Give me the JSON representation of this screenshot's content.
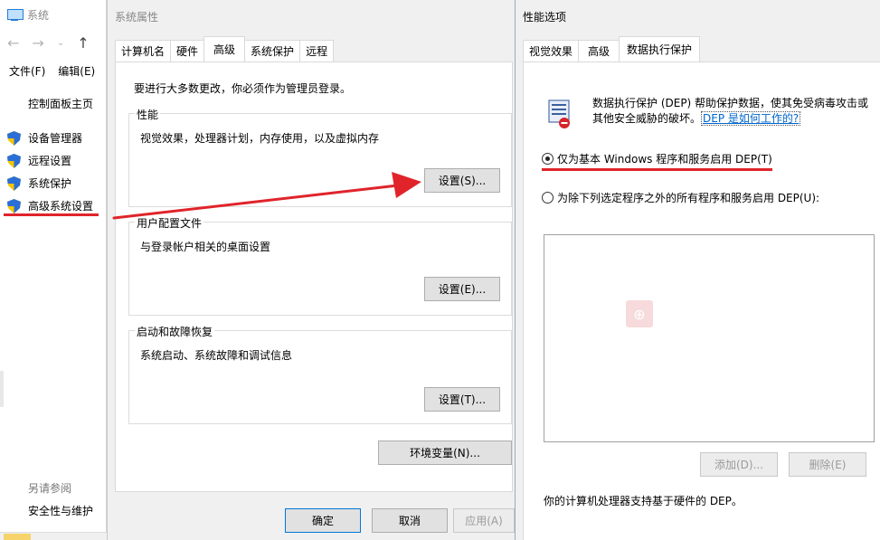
{
  "system": {
    "title": "系统",
    "menu": [
      "文件(F)",
      "编辑(E)"
    ],
    "home": "控制面板主页",
    "links": [
      "设备管理器",
      "远程设置",
      "系统保护",
      "高级系统设置"
    ],
    "see_also": "另请参阅",
    "security": "安全性与维护"
  },
  "props": {
    "title": "系统属性",
    "tabs": [
      "计算机名",
      "硬件",
      "高级",
      "系统保护",
      "远程"
    ],
    "active_tab": "高级",
    "intro": "要进行大多数更改，你必须作为管理员登录。",
    "performance": {
      "label": "性能",
      "desc": "视觉效果，处理器计划，内存使用，以及虚拟内存",
      "button": "设置(S)..."
    },
    "profile": {
      "label": "用户配置文件",
      "desc": "与登录帐户相关的桌面设置",
      "button": "设置(E)..."
    },
    "startup": {
      "label": "启动和故障恢复",
      "desc": "系统启动、系统故障和调试信息",
      "button": "设置(T)..."
    },
    "env_button": "环境变量(N)...",
    "ok": "确定",
    "cancel": "取消",
    "apply": "应用(A)"
  },
  "perf": {
    "title": "性能选项",
    "tabs": [
      "视觉效果",
      "高级",
      "数据执行保护"
    ],
    "active_tab": "数据执行保护",
    "dep_text": "数据执行保护 (DEP) 帮助保护数据，使其免受病毒攻击或其他安全威胁的破坏。",
    "dep_link": "DEP 是如何工作的?",
    "radio1": "仅为基本 Windows 程序和服务启用 DEP(T)",
    "radio2": "为除下列选定程序之外的所有程序和服务启用 DEP(U):",
    "radio1_selected": true,
    "add": "添加(D)...",
    "remove": "删除(E)",
    "support": "你的计算机处理器支持基于硬件的 DEP。"
  },
  "colors": {
    "annotation_red": "#e0242a",
    "link_blue": "#0066cc"
  }
}
